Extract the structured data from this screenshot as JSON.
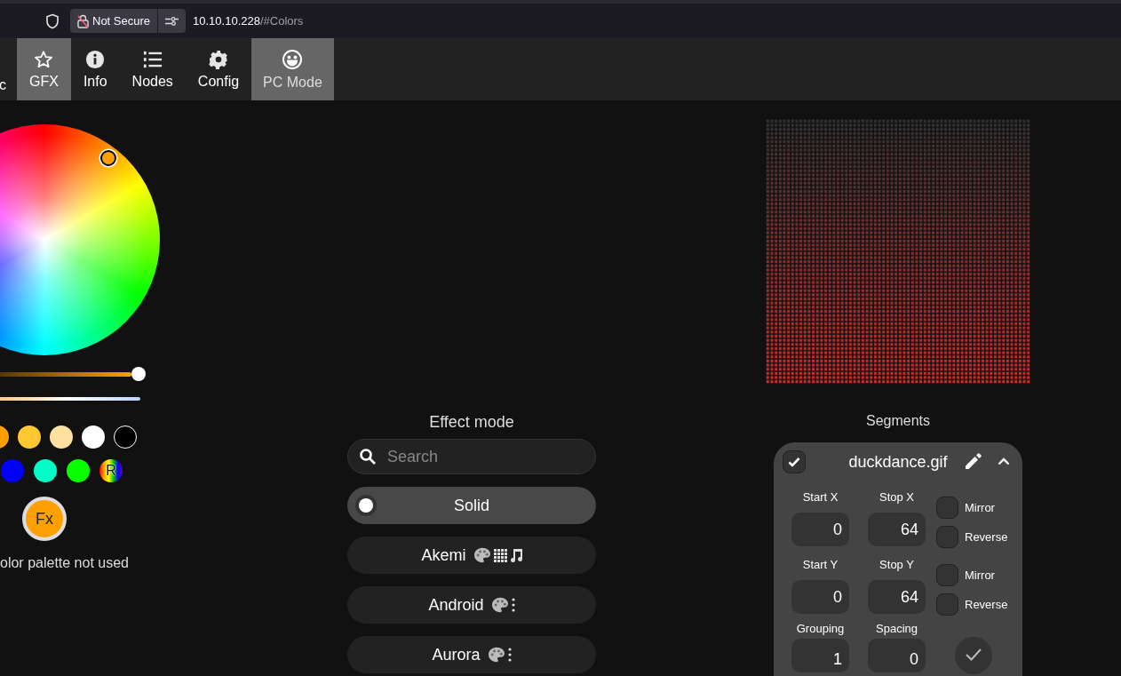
{
  "browser": {
    "address": {
      "security": "Not Secure",
      "host": "10.10.10.228",
      "path": "/#Colors"
    }
  },
  "nav": {
    "tabs": [
      {
        "label": "c",
        "selected": false
      },
      {
        "label": "GFX",
        "selected": true
      },
      {
        "label": "Info",
        "selected": false
      },
      {
        "label": "Nodes",
        "selected": false
      },
      {
        "label": "Config",
        "selected": false
      }
    ],
    "pc_mode": {
      "label": "PC Mode",
      "on": true
    }
  },
  "colors": {
    "brightness": {
      "level": 1
    },
    "quick_colors": [
      [
        {
          "kind": "color",
          "color": "#ffa000"
        },
        {
          "kind": "color",
          "color": "#ffc832"
        },
        {
          "kind": "color",
          "color": "#ffe0a0"
        },
        {
          "kind": "color",
          "color": "#ffffff"
        },
        {
          "kind": "color",
          "color": "#000000"
        }
      ],
      [
        {
          "kind": "color",
          "color": "#0000ff"
        },
        {
          "kind": "color",
          "color": "#00ffc8"
        },
        {
          "kind": "color",
          "color": "#08ff00"
        },
        {
          "kind": "random",
          "label": "R"
        }
      ]
    ],
    "fx_label": "Fx",
    "palette_note": "olor palette not used"
  },
  "effects": {
    "title": "Effect mode",
    "search": {
      "placeholder": "Search"
    },
    "items": [
      {
        "kind": "plain",
        "name": "Solid",
        "selected": true
      },
      {
        "kind": "matrix",
        "name": "Akemi",
        "selected": false
      },
      {
        "kind": "strip",
        "name": "Android",
        "selected": false
      },
      {
        "kind": "strip",
        "name": "Aurora",
        "selected": false
      }
    ]
  },
  "segments": {
    "title": "Segments",
    "items": [
      {
        "name": "duckdance.gif",
        "checked": true,
        "expanded": true,
        "axes": [
          {
            "start_label": "Start X",
            "start": "0",
            "stop_label": "Stop X",
            "stop": "64",
            "mirror": {
              "label": "Mirror",
              "checked": false
            },
            "reverse": {
              "label": "Reverse",
              "checked": false
            }
          },
          {
            "start_label": "Start Y",
            "start": "0",
            "stop_label": "Stop Y",
            "stop": "64",
            "mirror": {
              "label": "Mirror",
              "checked": false
            },
            "reverse": {
              "label": "Reverse",
              "checked": false
            }
          }
        ],
        "grouping": {
          "label": "Grouping",
          "value": "1"
        },
        "spacing": {
          "label": "Spacing",
          "value": "0"
        }
      }
    ]
  }
}
